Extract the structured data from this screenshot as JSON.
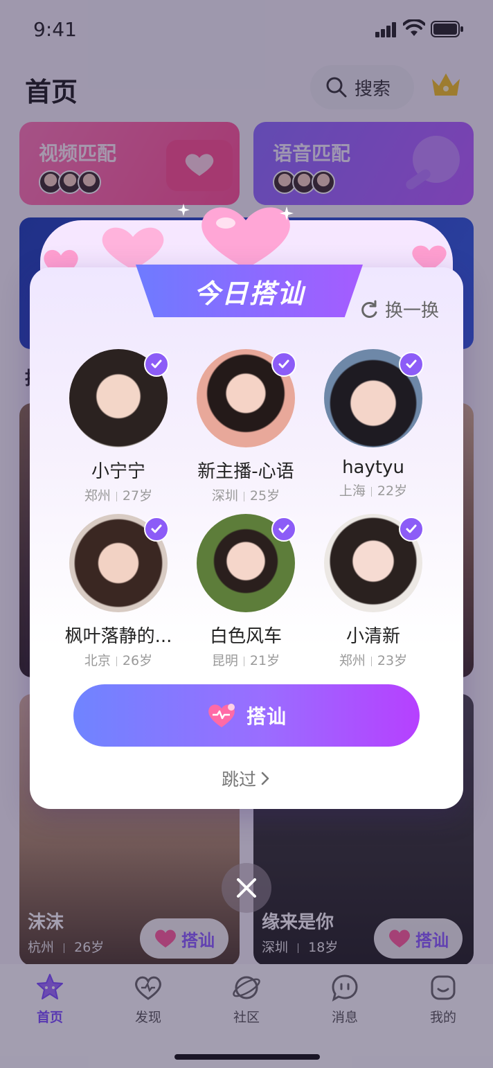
{
  "status_bar": {
    "time": "9:41"
  },
  "header": {
    "title": "首页",
    "search_label": "搜索"
  },
  "match_cards": [
    {
      "title": "视频匹配"
    },
    {
      "title": "语音匹配"
    }
  ],
  "background_cards": [
    {
      "name": "沫沫",
      "city": "杭州",
      "age": "26岁",
      "button": "搭讪"
    },
    {
      "name": "缘来是你",
      "city": "深圳",
      "age": "18岁",
      "button": "搭讪"
    }
  ],
  "tab_bar": [
    {
      "label": "首页",
      "icon": "star-face-icon",
      "active": true
    },
    {
      "label": "发现",
      "icon": "discover-heart-icon",
      "active": false
    },
    {
      "label": "社区",
      "icon": "community-planet-icon",
      "active": false
    },
    {
      "label": "消息",
      "icon": "message-bubble-icon",
      "active": false
    },
    {
      "label": "我的",
      "icon": "profile-face-icon",
      "active": false
    }
  ],
  "modal": {
    "title": "今日搭讪",
    "refresh_label": "换一换",
    "people": [
      {
        "name": "小宁宁",
        "city": "郑州",
        "age": "27岁",
        "selected": true
      },
      {
        "name": "新主播-心语",
        "city": "深圳",
        "age": "25岁",
        "selected": true
      },
      {
        "name": "haytyu",
        "city": "上海",
        "age": "22岁",
        "selected": true
      },
      {
        "name": "枫叶落静的...",
        "city": "北京",
        "age": "26岁",
        "selected": true
      },
      {
        "name": "白色风车",
        "city": "昆明",
        "age": "21岁",
        "selected": true
      },
      {
        "name": "小清新",
        "city": "郑州",
        "age": "23岁",
        "selected": true
      }
    ],
    "cta_label": "搭讪",
    "skip_label": "跳过"
  },
  "colors": {
    "accent_purple": "#8c5cf7",
    "cta_gradient_start": "#6f84ff",
    "cta_gradient_end": "#b640ff",
    "video_card": "#ff6aa8",
    "voice_card": "#9e65ff"
  }
}
